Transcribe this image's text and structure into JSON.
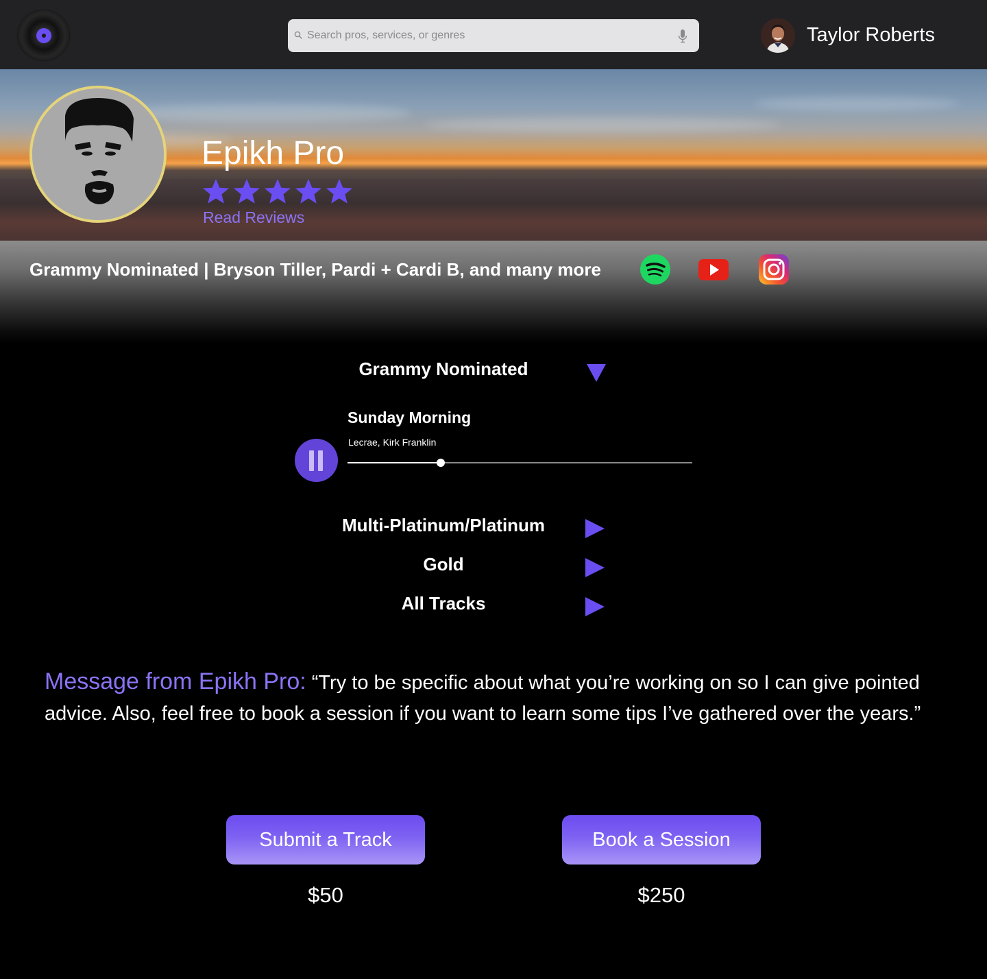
{
  "topbar": {
    "logo_icon": "vinyl-record-icon",
    "search": {
      "placeholder": "Search pros, services, or genres",
      "value": ""
    },
    "user": {
      "name": "Taylor Roberts"
    }
  },
  "profile": {
    "name": "Epikh Pro",
    "rating": 5,
    "rating_max": 5,
    "read_reviews_label": "Read Reviews",
    "credits": "Grammy Nominated | Bryson Tiller, Pardi + Cardi B, and many more",
    "social": [
      "spotify-icon",
      "youtube-icon",
      "instagram-icon"
    ]
  },
  "tracks": {
    "sections": [
      {
        "label": "Grammy Nominated",
        "expanded": true
      },
      {
        "label": "Multi-Platinum/Platinum",
        "expanded": false
      },
      {
        "label": "Gold",
        "expanded": false
      },
      {
        "label": "All Tracks",
        "expanded": false
      }
    ],
    "now_playing": {
      "title": "Sunday Morning",
      "artist": "Lecrae, Kirk Franklin",
      "progress": 0.27,
      "state": "playing"
    }
  },
  "message": {
    "label": "Message from Epikh Pro:",
    "text": " “Try to be specific about what you’re working on so I can give pointed advice. Also, feel free to book a session if you want to learn some tips I’ve gathered over the years.”"
  },
  "actions": [
    {
      "label": "Submit a Track",
      "price": "$50"
    },
    {
      "label": "Book a Session",
      "price": "$250"
    }
  ],
  "colors": {
    "accent": "#8b73f6",
    "button": "#7e62f2",
    "avatar_ring": "#e5d47a",
    "topbar_bg": "#222224"
  }
}
